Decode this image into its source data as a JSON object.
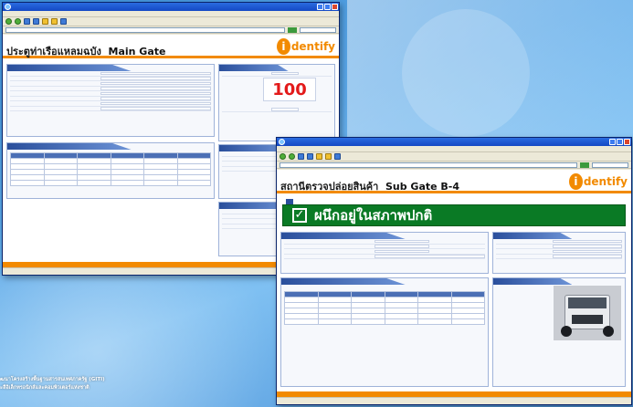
{
  "window_main": {
    "banner_subtitle": "",
    "title_thai": "ประตูท่าเรือแหลมฉบัง",
    "title_en": "Main Gate",
    "logo_letter": "i",
    "logo_word": "dentify",
    "big_number": "100"
  },
  "window_sub": {
    "banner_subtitle": "",
    "title_thai": "สถานีตรวจปล่อยสินค้า",
    "title_en": "Sub Gate B-4",
    "logo_letter": "i",
    "logo_word": "dentify",
    "status_message": "ผนึกอยู่ในสภาพปกติ",
    "status_check": "✓"
  },
  "caption": {
    "line1": "ฒนาโครงสร้างพื้นฐานสารสนเทศภาครัฐ  (GITI)",
    "line2": "ะลีอิเล็กทรอนิกส์และคอมพิวเตอร์แห่งชาติ"
  },
  "colors": {
    "accent_orange": "#f28a00",
    "status_green": "#0a7a25",
    "number_red": "#e31a1a",
    "xp_blue": "#1449c4"
  }
}
